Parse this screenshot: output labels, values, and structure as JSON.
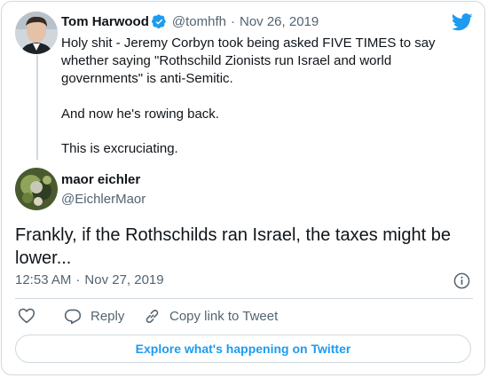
{
  "quoted_tweet": {
    "author_name": "Tom Harwood",
    "author_handle": "@tomhfh",
    "separator": "·",
    "date": "Nov 26, 2019",
    "text_lines": [
      "Holy shit - Jeremy Corbyn took being asked FIVE TIMES to say",
      "whether saying \"Rothschild Zionists run Israel and world",
      "governments\" is anti-Semitic."
    ],
    "text_2": "And now he's rowing back.",
    "text_3": "This is excruciating."
  },
  "main_tweet": {
    "author_name": "maor eichler",
    "author_handle": "@EichlerMaor",
    "text_lines": [
      "Frankly, if the Rothschilds ran Israel, the taxes might be",
      "lower..."
    ],
    "time": "12:53 AM",
    "separator": "·",
    "date": "Nov 27, 2019"
  },
  "actions": {
    "reply_label": "Reply",
    "copy_link_label": "Copy link to Tweet"
  },
  "explore_label": "Explore what's happening on Twitter",
  "colors": {
    "twitter_blue": "#1d9bf0",
    "verified_blue": "#1d9bf0",
    "text": "#0f1419",
    "muted": "#536471",
    "border": "#cfd9de"
  },
  "icons": [
    "twitter-bird-icon",
    "verified-badge-icon",
    "info-icon",
    "heart-icon",
    "reply-icon",
    "link-icon"
  ]
}
